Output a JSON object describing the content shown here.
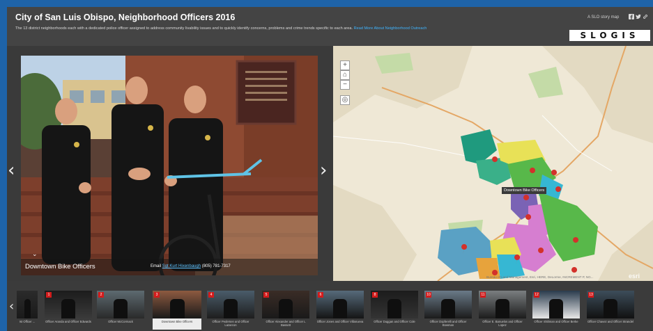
{
  "header": {
    "title": "City of San Luis Obispo, Neighborhood Officers 2016",
    "subtitle": "The 13 district neighborhoods each with a dedicated police officer assigned to address community livability issues and to quickly identify concerns, problems and crime trends specific to each area.",
    "subtitle_link": "Read More About Neighborhood Outreach",
    "story_map_label": "A SLO story map",
    "share_icons": [
      "facebook-icon",
      "twitter-icon",
      "link-icon"
    ],
    "logo": "SLOGIS"
  },
  "photo": {
    "caption": "Downtown Bike Officers",
    "email_prefix": "Email",
    "email_link": "Sgt Kurt Hixenbaugh",
    "phone": "(805) 781-7317"
  },
  "map": {
    "zoom_in": "+",
    "home": "⌂",
    "zoom_out": "−",
    "locate": "◎",
    "tooltip": "Downtown Bike Officers",
    "attribution": "Bureau of Land Management, Esri, HERE, DeLorme, INCREMENT P, NG...",
    "esri_logo": "esri",
    "colors": {
      "teal": "#1f9a7e",
      "blue": "#5aa1c4",
      "yellow": "#e8e157",
      "magenta": "#d67ed0",
      "green": "#58b84a",
      "purple": "#7a63b5",
      "cyan": "#36b7d3",
      "orange": "#e7a33c",
      "pin": "#d3312b"
    }
  },
  "carousel": {
    "thumbnails": [
      {
        "num": "",
        "label": "Ist Officer ...",
        "active": false
      },
      {
        "num": "1",
        "label": "Officer Aranda and Officer Edwards",
        "active": false
      },
      {
        "num": "2",
        "label": "Officer McCormack",
        "active": false
      },
      {
        "num": "3",
        "label": "Downtown Bike Officers",
        "active": true
      },
      {
        "num": "4",
        "label": "Officer Pedersen and Officer Lazarcon",
        "active": false
      },
      {
        "num": "5",
        "label": "Officer Alexander and Officer L Bassett",
        "active": false
      },
      {
        "num": "6",
        "label": "Officer Jones and Officer Villanueva",
        "active": false
      },
      {
        "num": "8",
        "label": "Officer Duggan and Officer Cole",
        "active": false
      },
      {
        "num": "10",
        "label": "Officer Dopferelli and Officer Bowman",
        "active": false
      },
      {
        "num": "11",
        "label": "Officer E. Banuelos and Officer Lopez",
        "active": false
      },
      {
        "num": "12",
        "label": "Officer Shiliman and Officer Berke",
        "active": false
      },
      {
        "num": "13",
        "label": "Officer Chavez and Officer Strandel",
        "active": false
      }
    ]
  }
}
